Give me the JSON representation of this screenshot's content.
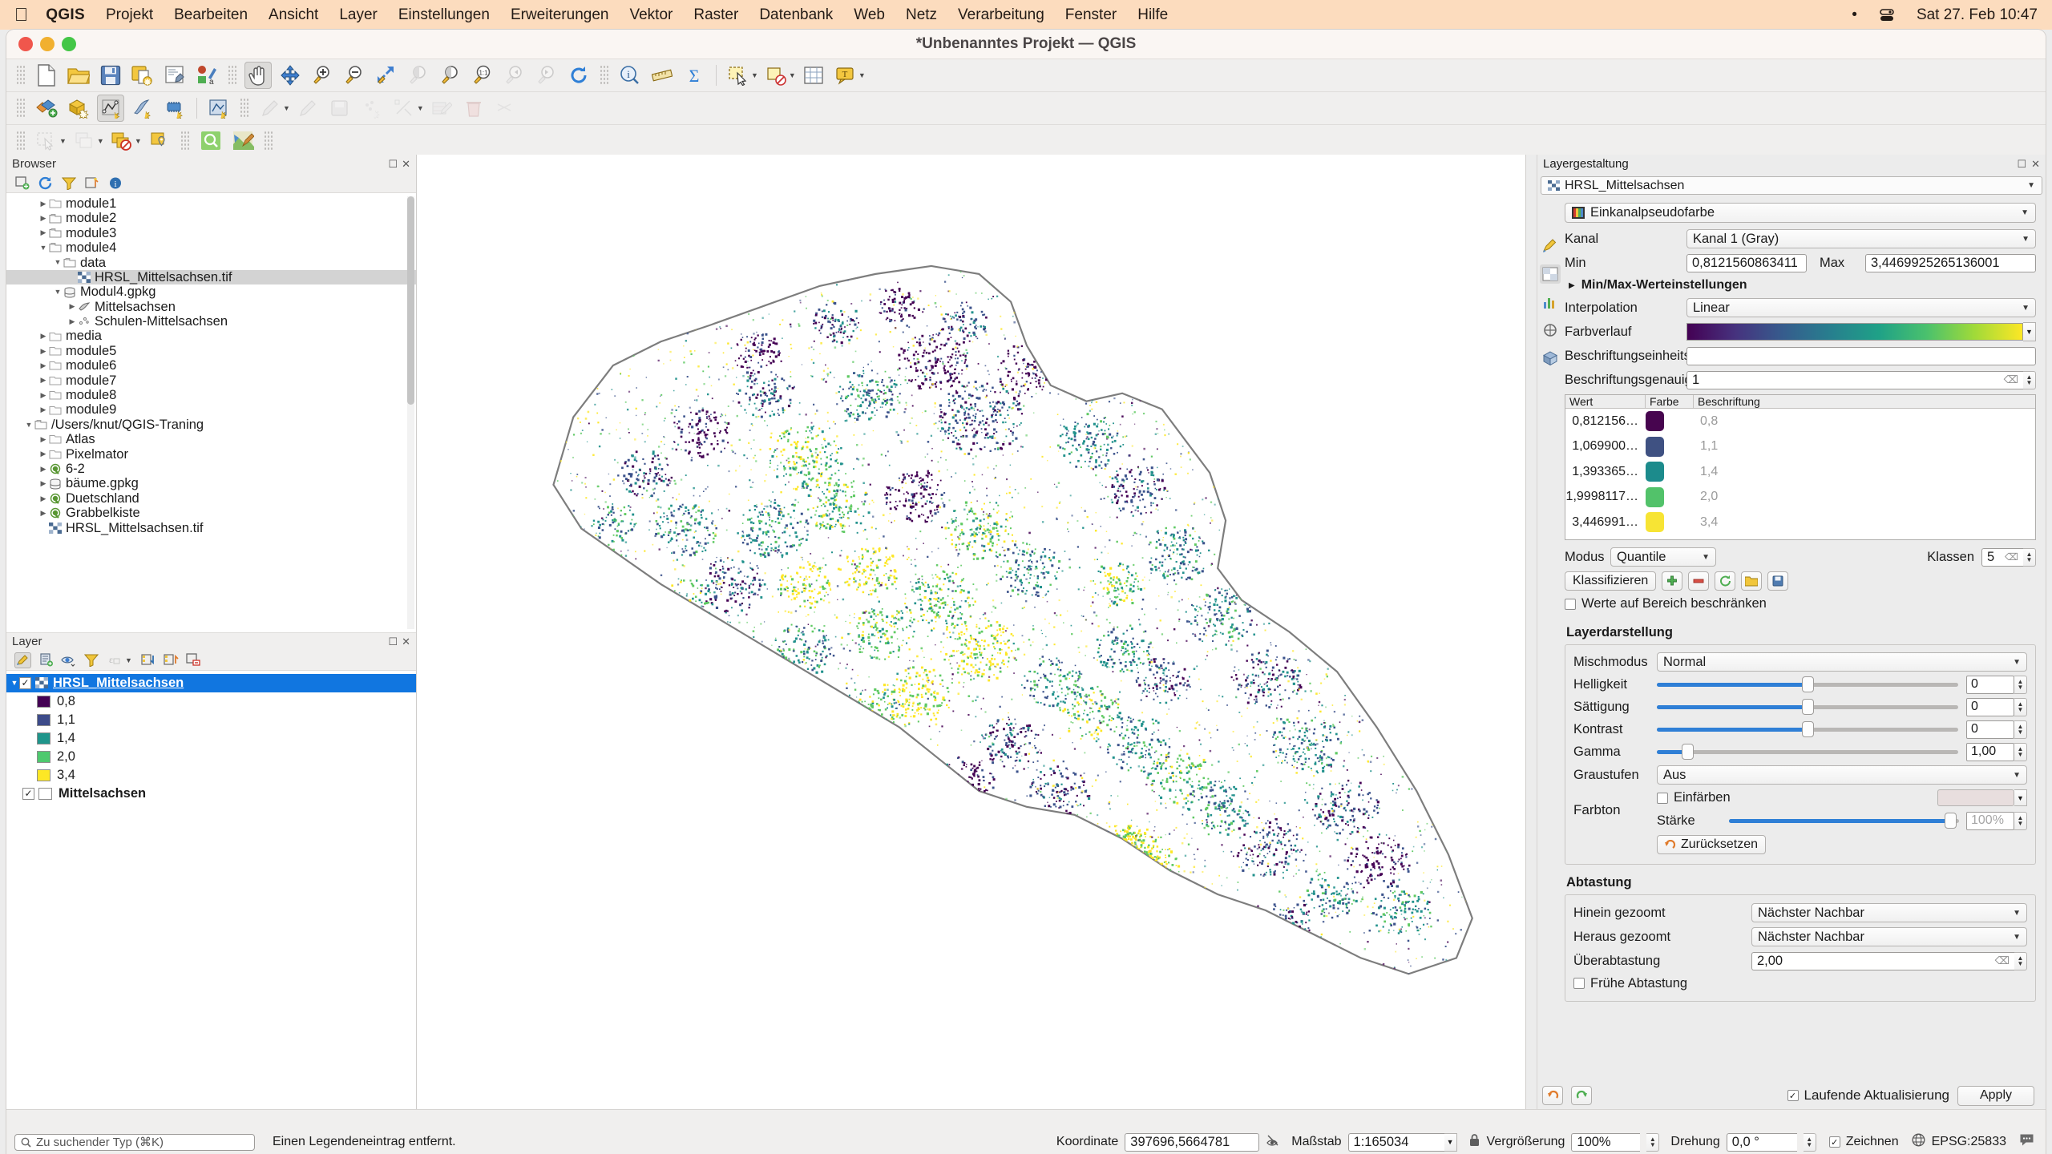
{
  "macbar": {
    "apple": "apple-logo",
    "app": "QGIS",
    "menus": [
      "Projekt",
      "Bearbeiten",
      "Ansicht",
      "Layer",
      "Einstellungen",
      "Erweiterungen",
      "Vektor",
      "Raster",
      "Datenbank",
      "Web",
      "Netz",
      "Verarbeitung",
      "Fenster",
      "Hilfe"
    ],
    "clock": "Sat 27. Feb  10:47",
    "bullet": "•"
  },
  "window": {
    "title": "*Unbenanntes Projekt — QGIS"
  },
  "browser": {
    "title": "Browser",
    "toolbar": [
      "add-layer-icon",
      "refresh-icon",
      "filter-icon",
      "collapse-all-icon",
      "info-icon"
    ],
    "items": [
      {
        "label": "module1",
        "depth": 1,
        "twisty": "▶",
        "icon": "folder-plain",
        "sel": false
      },
      {
        "label": "module2",
        "depth": 1,
        "twisty": "▶",
        "icon": "folder",
        "sel": false
      },
      {
        "label": "module3",
        "depth": 1,
        "twisty": "▶",
        "icon": "folder",
        "sel": false
      },
      {
        "label": "module4",
        "depth": 1,
        "twisty": "▼",
        "icon": "folder",
        "sel": false
      },
      {
        "label": "data",
        "depth": 2,
        "twisty": "▼",
        "icon": "folder",
        "sel": false
      },
      {
        "label": "HRSL_Mittelsachsen.tif",
        "depth": 3,
        "twisty": "",
        "icon": "raster",
        "sel": true
      },
      {
        "label": "Modul4.gpkg",
        "depth": 2,
        "twisty": "▼",
        "icon": "gpkg",
        "sel": false
      },
      {
        "label": "Mittelsachsen",
        "depth": 3,
        "twisty": "▶",
        "icon": "polygon",
        "sel": false
      },
      {
        "label": "Schulen-Mittelsachsen",
        "depth": 3,
        "twisty": "▶",
        "icon": "point",
        "sel": false
      },
      {
        "label": "media",
        "depth": 1,
        "twisty": "▶",
        "icon": "folder-plain",
        "sel": false
      },
      {
        "label": "module5",
        "depth": 1,
        "twisty": "▶",
        "icon": "folder-plain",
        "sel": false
      },
      {
        "label": "module6",
        "depth": 1,
        "twisty": "▶",
        "icon": "folder-plain",
        "sel": false
      },
      {
        "label": "module7",
        "depth": 1,
        "twisty": "▶",
        "icon": "folder-plain",
        "sel": false
      },
      {
        "label": "module8",
        "depth": 1,
        "twisty": "▶",
        "icon": "folder-plain",
        "sel": false
      },
      {
        "label": "module9",
        "depth": 1,
        "twisty": "▶",
        "icon": "folder-plain",
        "sel": false
      },
      {
        "label": "/Users/knut/QGIS-Traning",
        "depth": 0,
        "twisty": "▼",
        "icon": "folder",
        "sel": false
      },
      {
        "label": "Atlas",
        "depth": 1,
        "twisty": "▶",
        "icon": "folder-plain",
        "sel": false
      },
      {
        "label": "Pixelmator",
        "depth": 1,
        "twisty": "▶",
        "icon": "folder-plain",
        "sel": false
      },
      {
        "label": "6-2",
        "depth": 1,
        "twisty": "▶",
        "icon": "qgis",
        "sel": false
      },
      {
        "label": "bäume.gpkg",
        "depth": 1,
        "twisty": "▶",
        "icon": "gpkg",
        "sel": false
      },
      {
        "label": "Duetschland",
        "depth": 1,
        "twisty": "▶",
        "icon": "qgis",
        "sel": false
      },
      {
        "label": "Grabbelkiste",
        "depth": 1,
        "twisty": "▶",
        "icon": "qgis",
        "sel": false
      },
      {
        "label": "HRSL_Mittelsachsen.tif",
        "depth": 1,
        "twisty": "",
        "icon": "raster",
        "sel": false
      }
    ]
  },
  "layerpanel": {
    "title": "Layer",
    "toolbar": [
      "styling-dock-icon",
      "add-group-icon",
      "manage-visibility-icon",
      "filter-legend-icon",
      "expression-filter-icon",
      "expand-all-icon",
      "collapse-all-icon",
      "remove-layer-icon"
    ],
    "layers": [
      {
        "name": "HRSL_Mittelsachsen",
        "checked": true,
        "selected": true,
        "expanded": true,
        "type": "raster"
      },
      {
        "name": "Mittelsachsen",
        "checked": true,
        "selected": false,
        "expanded": false,
        "type": "vector",
        "swatch": "#ffffff"
      }
    ],
    "legend": [
      {
        "label": "0,8",
        "color": "#440154"
      },
      {
        "label": "1,1",
        "color": "#3d4b8a"
      },
      {
        "label": "1,4",
        "color": "#1f958b"
      },
      {
        "label": "2,0",
        "color": "#4ec96e"
      },
      {
        "label": "3,4",
        "color": "#fde725"
      }
    ]
  },
  "styling": {
    "title": "Layergestaltung",
    "layer_name": "HRSL_Mittelsachsen",
    "renderer": "Einkanalpseudofarbe",
    "band_label": "Kanal",
    "band_value": "Kanal 1 (Gray)",
    "min_label": "Min",
    "min_value": "0,8121560863411",
    "max_label": "Max",
    "max_value": "3,4469925265136001",
    "minmax_section": "Min/Max-Werteinstellungen",
    "interpolation_label": "Interpolation",
    "interpolation_value": "Linear",
    "ramp_label": "Farbverlauf",
    "ramp_name": "viridis",
    "suffix_label": "Beschriftungseinheitssuffix",
    "suffix_value": "",
    "precision_label": "Beschriftungsgenauigkeit",
    "precision_value": "1",
    "table_headers": [
      "Wert",
      "Farbe",
      "Beschriftung"
    ],
    "table_rows": [
      {
        "value": "0,812156…",
        "color": "#47054f",
        "label": "0,8"
      },
      {
        "value": "1,069900…",
        "color": "#3f5182",
        "label": "1,1"
      },
      {
        "value": "1,393365…",
        "color": "#1c8b8c",
        "label": "1,4"
      },
      {
        "value": "1,9998117…",
        "color": "#52c26a",
        "label": "2,0"
      },
      {
        "value": "3,446991…",
        "color": "#f7e434",
        "label": "3,4"
      }
    ],
    "mode_label": "Modus",
    "mode_value": "Quantile",
    "classes_label": "Klassen",
    "classes_value": "5",
    "classify_button": "Klassifizieren",
    "class_buttons": [
      "add-class-icon",
      "remove-class-icon",
      "reload-icon",
      "load-ramp-icon",
      "save-ramp-icon"
    ],
    "clip_label": "Werte auf Bereich beschränken",
    "clip_checked": false,
    "render_section": "Layerdarstellung",
    "blend_label": "Mischmodus",
    "blend_value": "Normal",
    "brightness_label": "Helligkeit",
    "brightness_value": "0",
    "saturation_label": "Sättigung",
    "saturation_value": "0",
    "contrast_label": "Kontrast",
    "contrast_value": "0",
    "gamma_label": "Gamma",
    "gamma_value": "1,00",
    "grayscale_label": "Graustufen",
    "grayscale_value": "Aus",
    "hue_label": "Farbton",
    "colorize_label": "Einfärben",
    "colorize_checked": false,
    "strength_label": "Stärke",
    "strength_value": "100%",
    "reset_button": "Zurücksetzen",
    "resample_section": "Abtastung",
    "zoomedin_label": "Hinein gezoomt",
    "zoomedin_value": "Nächster Nachbar",
    "zoomedout_label": "Heraus gezoomt",
    "zoomedout_value": "Nächster Nachbar",
    "oversampling_label": "Überabtastung",
    "oversampling_value": "2,00",
    "early_label": "Frühe Abtastung",
    "early_checked": false,
    "live_update_label": "Laufende Aktualisierung",
    "live_update_checked": true,
    "apply_button": "Apply",
    "undo_icon": "undo-icon",
    "redo_icon": "redo-icon",
    "side_tabs": [
      "symbology-tab",
      "transparency-tab",
      "histogram-tab",
      "rendering-tab",
      "3dview-tab"
    ]
  },
  "statusbar": {
    "search_placeholder": "Zu suchender Typ (⌘K)",
    "message": "Einen Legendeneintrag entfernt.",
    "coordinate_label": "Koordinate",
    "coordinate_value": "397696,5664781",
    "scale_label": "Maßstab",
    "scale_value": "1:165034",
    "magnifier_label": "Vergrößerung",
    "magnifier_value": "100%",
    "rotation_label": "Drehung",
    "rotation_value": "0,0 °",
    "render_label": "Zeichnen",
    "render_checked": true,
    "crs_label": "EPSG:25833",
    "lock_icon": "lock-icon",
    "globe_icon": "globe-icon",
    "message_icon": "messages-icon"
  },
  "toolbars": {
    "row1": [
      "new-project-icon",
      "open-project-icon",
      "save-project-icon",
      "save-project-as-icon",
      "new-print-layout-icon",
      "style-manager-icon",
      "pan-map-icon",
      "pan-to-selection-icon",
      "zoom-in-icon",
      "zoom-out-icon",
      "zoom-full-icon",
      "zoom-to-selection-icon",
      "zoom-to-layer-icon",
      "zoom-native-icon",
      "zoom-last-icon",
      "zoom-next-icon",
      "refresh-icon",
      "identify-icon",
      "measure-icon",
      "statistics-icon",
      "select-features-icon",
      "deselect-icon",
      "open-attribute-table-icon",
      "text-annotation-icon"
    ],
    "row2": [
      "add-vector-layer-icon",
      "add-raster-layer-icon",
      "add-delimited-layer-icon",
      "add-virtual-layer-icon",
      "add-mesh-layer-icon",
      "new-geopackage-icon",
      "toggle-editing-icon",
      "edit-pencil-icon",
      "save-layer-edits-icon",
      "add-feature-icon",
      "vertex-tool-icon",
      "modify-attributes-icon",
      "delete-selected-icon",
      "cut-features-icon"
    ],
    "row3": [
      "select-rect-icon",
      "select-value-icon",
      "select-all-icon",
      "deselect-all-icon",
      "select-location-icon",
      "zoom-to-selected-icon",
      "search-icon",
      "style-icon"
    ]
  },
  "map": {
    "canvas_name": "map-canvas",
    "region": "Mittelsachsen",
    "layer": "HRSL_Mittelsachsen population raster"
  }
}
